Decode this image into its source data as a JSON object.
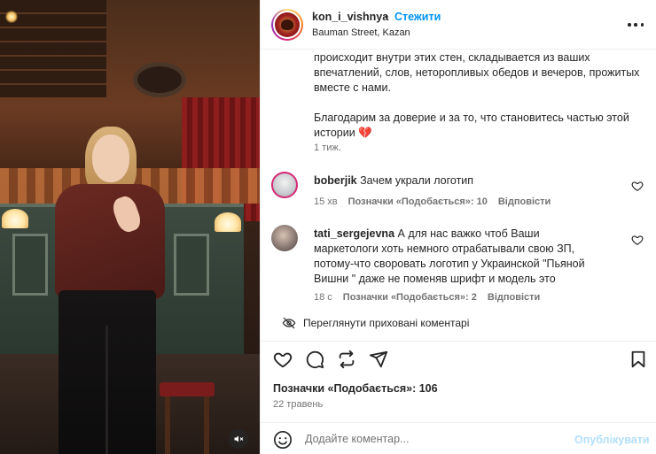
{
  "post": {
    "username": "kon_i_vishnya",
    "separator": "•",
    "follow_label": "Стежити",
    "location": "Bauman Street, Kazan",
    "caption_lines": [
      "происходит внутри этих стен, складывается из ваших впечатлений, слов, неторопливых обедов и вечеров, прожитых вместе с нами.",
      "Благодарим за доверие и за то, что становитесь частью этой истории"
    ],
    "caption_emoji": "💔",
    "caption_time": "1 тиж."
  },
  "comments": [
    {
      "username": "boberjik",
      "text": "Зачем украли логотип",
      "time": "15 хв",
      "likes_label": "Позначки «Подобається»: 10",
      "reply_label": "Відповісти",
      "avatar_color": "#c9cbd0"
    },
    {
      "username": "tati_sergejevna",
      "text": "А для нас важко чтоб Ваши маркетологи хоть немного отрабатывали свою ЗП, потому-что своровать логотип у Украинской \"Пьяной Вишни \" даже не поменяв шрифт и модель это",
      "time": "18 с",
      "likes_label": "Позначки «Подобається»: 2",
      "reply_label": "Відповісти",
      "avatar_color": "#8a7a74"
    }
  ],
  "hidden_comments_label": "Переглянути приховані коментарі",
  "likes_summary": "Позначки «Подобається»: 106",
  "post_date": "22 травень",
  "composer": {
    "placeholder": "Додайте коментар...",
    "post_label": "Опублікувати"
  },
  "colors": {
    "accent": "#0095f6",
    "post_disabled": "#b2dffc",
    "muted_text": "#737373",
    "text": "#262626"
  },
  "icons": {
    "like": "heart-icon",
    "comment": "comment-bubble-icon",
    "repost": "repost-icon",
    "share": "paper-plane-icon",
    "save": "bookmark-icon",
    "more": "more-horizontal-icon",
    "emoji": "smiley-icon",
    "mute": "speaker-muted-icon",
    "hidden": "eye-off-icon"
  }
}
